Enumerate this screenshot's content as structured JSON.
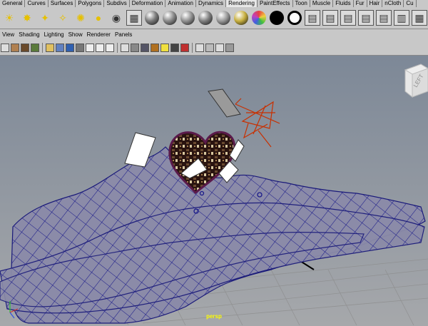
{
  "shelf_tabs": [
    "General",
    "Curves",
    "Surfaces",
    "Polygons",
    "Subdivs",
    "Deformation",
    "Animation",
    "Dynamics",
    "Rendering",
    "PaintEffects",
    "Toon",
    "Muscle",
    "Fluids",
    "Fur",
    "Hair",
    "nCloth",
    "Cu"
  ],
  "active_shelf_tab": "Rendering",
  "shelf_icons": [
    {
      "name": "directional-light-icon",
      "glyph": "☀",
      "color": "#e6c000"
    },
    {
      "name": "spot-light-icon",
      "glyph": "✸",
      "color": "#e6c000"
    },
    {
      "name": "point-light-icon",
      "glyph": "✦",
      "color": "#e6c000"
    },
    {
      "name": "area-light-icon",
      "glyph": "✧",
      "color": "#e6c000"
    },
    {
      "name": "volume-light-icon",
      "glyph": "✺",
      "color": "#e6c000"
    },
    {
      "name": "ambient-light-icon",
      "glyph": "●",
      "color": "#e6c000"
    },
    {
      "name": "camera-icon",
      "glyph": "◉",
      "color": "#333"
    },
    {
      "name": "aim-camera-icon",
      "glyph": "▦",
      "color": "#333",
      "boxed": true
    },
    {
      "name": "lambert-shader-icon",
      "sphere": "#7a7a7a"
    },
    {
      "name": "blinn-shader-icon",
      "sphere": "#8a8a8a"
    },
    {
      "name": "phong-shader-icon",
      "sphere": "#909090"
    },
    {
      "name": "phong-e-shader-icon",
      "sphere": "#7f7f7f"
    },
    {
      "name": "anisotropic-shader-icon",
      "sphere": "#9a9a9a"
    },
    {
      "name": "ramp-shader-icon",
      "sphere": "#c8b040"
    },
    {
      "name": "ramp-color-shader-icon",
      "sphere": "#e84040"
    },
    {
      "name": "surface-shader-icon",
      "sphere": "#000000"
    },
    {
      "name": "use-background-shader-icon",
      "sphere": "#ffffff",
      "ring": true
    },
    {
      "name": "render-current-frame-icon",
      "glyph": "▤",
      "color": "#333",
      "boxed": true
    },
    {
      "name": "ipr-render-icon",
      "glyph": "▤",
      "color": "#333",
      "boxed": true
    },
    {
      "name": "render-settings-icon",
      "glyph": "▤",
      "color": "#333",
      "boxed": true
    },
    {
      "name": "render-view-icon",
      "glyph": "▤",
      "color": "#333",
      "boxed": true
    },
    {
      "name": "batch-render-icon",
      "glyph": "▤",
      "color": "#333",
      "boxed": true
    },
    {
      "name": "hypershade-icon",
      "glyph": "▥",
      "color": "#333",
      "boxed": true
    },
    {
      "name": "light-linking-icon",
      "glyph": "▦",
      "color": "#333",
      "boxed": true
    },
    {
      "name": "break-light-links-icon",
      "glyph": "✕",
      "color": "#d00000",
      "boxed": true
    },
    {
      "name": "render-layer-icon",
      "glyph": "▤",
      "color": "#333",
      "boxed": true
    }
  ],
  "panel_menu": [
    "View",
    "Shading",
    "Lighting",
    "Show",
    "Renderer",
    "Panels"
  ],
  "view_cube_label": "LEFT",
  "camera_label": "persp"
}
